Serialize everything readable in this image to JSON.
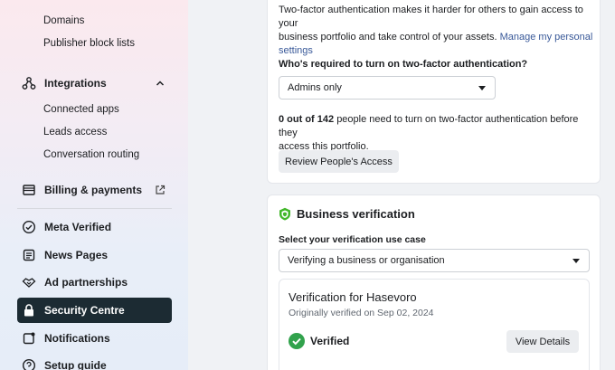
{
  "sidebar": {
    "sub_items_top": [
      "Domains",
      "Publisher block lists"
    ],
    "integrations": {
      "label": "Integrations",
      "children": [
        "Connected apps",
        "Leads access",
        "Conversation routing"
      ]
    },
    "billing": "Billing & payments",
    "meta_verified": "Meta Verified",
    "news_pages": "News Pages",
    "ad_partnerships": "Ad partnerships",
    "security_centre": "Security Centre",
    "notifications": "Notifications",
    "setup_guide": "Setup guide"
  },
  "two_factor": {
    "desc_line1": "Two-factor authentication makes it harder for others to gain access to your",
    "desc_line2_pre": "business portfolio and take control of your assets.",
    "desc_link_1": "Manage my personal",
    "desc_link_2": "settings",
    "question": "Who's required to turn on two-factor authentication?",
    "select_value": "Admins only",
    "count_bold": "0 out of 142",
    "count_rest": "people need to turn on two-factor authentication before they",
    "count_line2": "access this portfolio.",
    "review_button": "Review People's Access"
  },
  "verification": {
    "title": "Business verification",
    "use_case_label": "Select your verification use case",
    "use_case_value": "Verifying a business or organisation",
    "inner_title": "Verification for Hasevoro",
    "inner_subtitle": "Originally verified on Sep 02, 2024",
    "status": "Verified",
    "details_button": "View Details"
  },
  "colors": {
    "active_bg": "#1c2b33",
    "link": "#385898",
    "verified_green": "#31a24c",
    "shield_green": "#42b72a"
  }
}
